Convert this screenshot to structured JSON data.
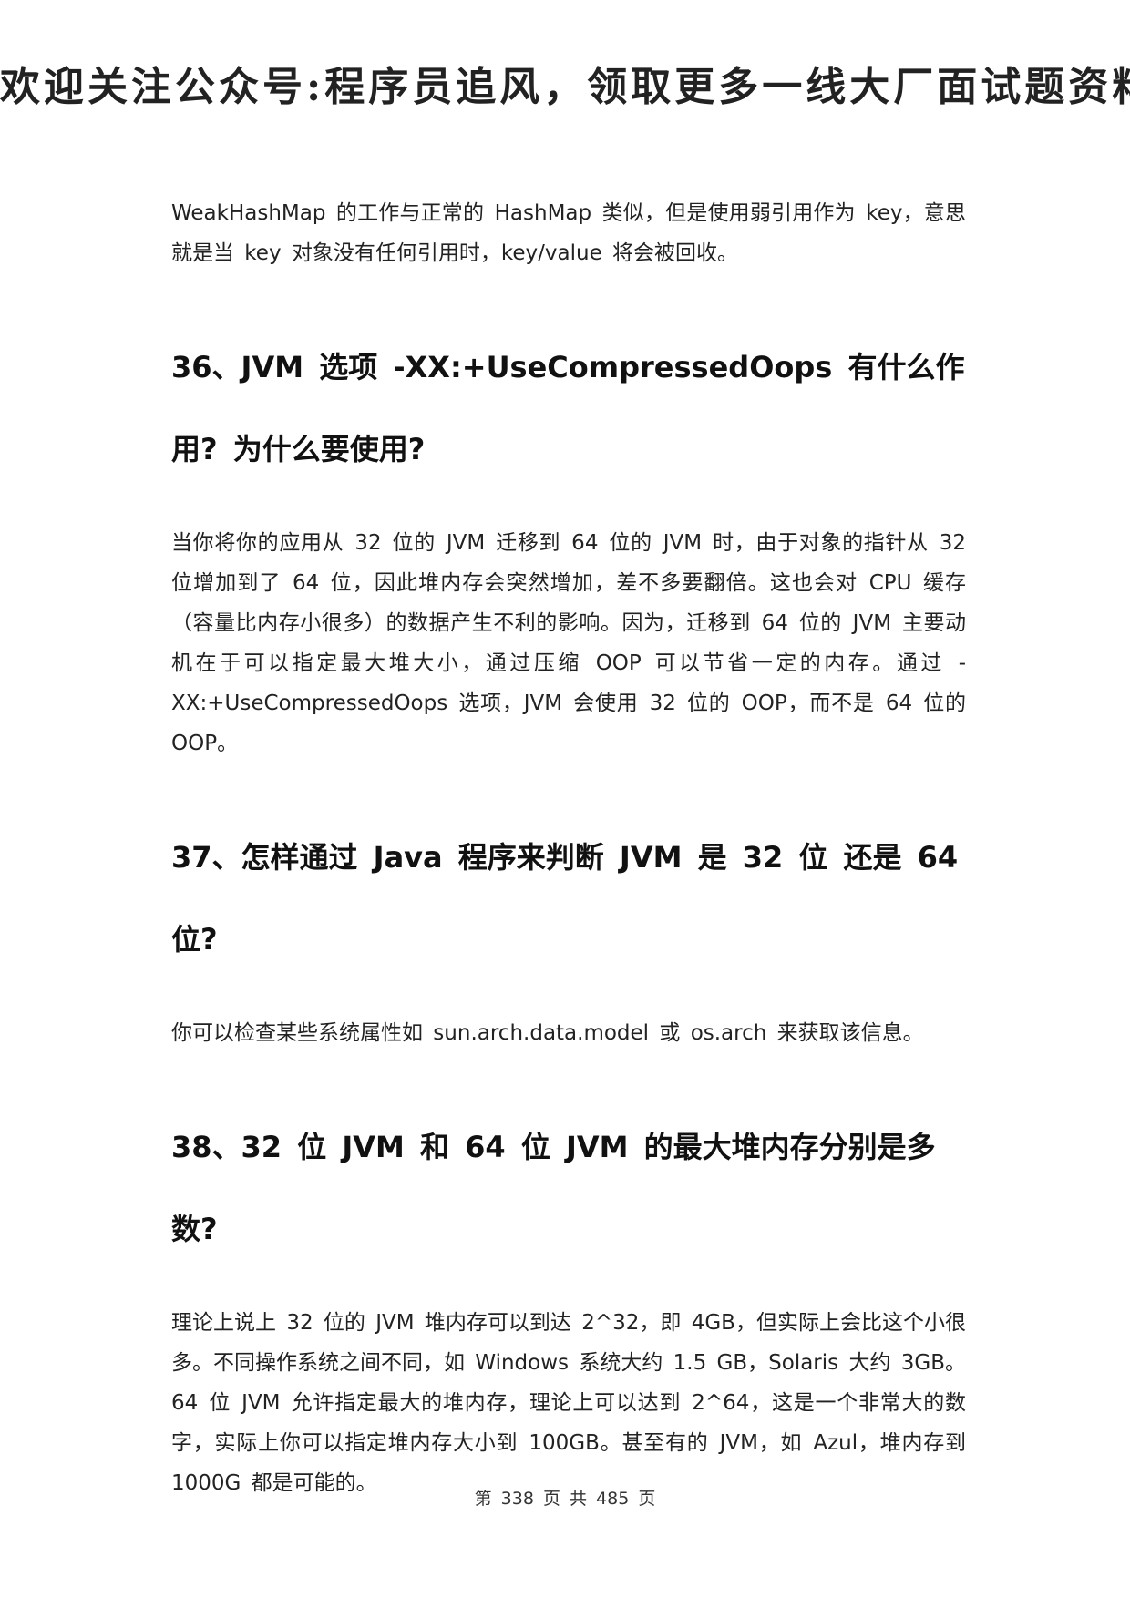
{
  "header": {
    "banner": "欢迎关注公众号:程序员追风，领取更多一线大厂面试题资料"
  },
  "sections": [
    {
      "intro": "WeakHashMap 的工作与正常的 HashMap 类似，但是使用弱引用作为 key，意思就是当 key 对象没有任何引用时，key/value 将会被回收。"
    },
    {
      "title": "36、JVM 选项 -XX:+UseCompressedOops 有什么作用? 为什么要使用?",
      "body": "当你将你的应用从 32 位的 JVM 迁移到 64 位的 JVM 时，由于对象的指针从 32 位增加到了 64 位，因此堆内存会突然增加，差不多要翻倍。这也会对 CPU 缓存（容量比内存小很多）的数据产生不利的影响。因为，迁移到 64 位的 JVM 主要动机在于可以指定最大堆大小，通过压缩 OOP 可以节省一定的内存。通过 -XX:+UseCompressedOops 选项，JVM 会使用 32 位的 OOP，而不是 64 位的 OOP。"
    },
    {
      "title": "37、怎样通过 Java 程序来判断 JVM 是 32 位 还是 64 位?",
      "body": "你可以检查某些系统属性如 sun.arch.data.model 或 os.arch 来获取该信息。"
    },
    {
      "title": "38、32 位 JVM 和 64 位 JVM 的最大堆内存分别是多数?",
      "body": "理论上说上 32 位的 JVM 堆内存可以到达 2^32，即 4GB，但实际上会比这个小很多。不同操作系统之间不同，如 Windows 系统大约 1.5 GB，Solaris 大约 3GB。64 位 JVM 允许指定最大的堆内存，理论上可以达到 2^64，这是一个非常大的数字，实际上你可以指定堆内存大小到 100GB。甚至有的 JVM，如 Azul，堆内存到 1000G 都是可能的。"
    }
  ],
  "footer": {
    "page_label": "第 338 页 共 485 页"
  }
}
